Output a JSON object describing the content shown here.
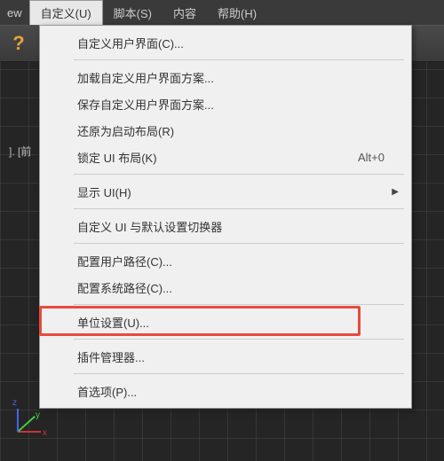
{
  "menubar": {
    "items": [
      {
        "label": "ew"
      },
      {
        "label": "自定义(U)",
        "active": true
      },
      {
        "label": "脚本(S)"
      },
      {
        "label": "内容"
      },
      {
        "label": "帮助(H)"
      }
    ]
  },
  "toolbar": {
    "help_icon": "?"
  },
  "viewport": {
    "label": "]. [前"
  },
  "axis": {
    "x": "x",
    "y": "y",
    "z": "z"
  },
  "dropdown": {
    "items": [
      {
        "type": "item",
        "label": "自定义用户界面(C)..."
      },
      {
        "type": "separator"
      },
      {
        "type": "item",
        "label": "加载自定义用户界面方案..."
      },
      {
        "type": "item",
        "label": "保存自定义用户界面方案..."
      },
      {
        "type": "item",
        "label": "还原为启动布局(R)"
      },
      {
        "type": "item",
        "label": "锁定 UI 布局(K)",
        "shortcut": "Alt+0"
      },
      {
        "type": "separator"
      },
      {
        "type": "item",
        "label": "显示 UI(H)",
        "submenu": true
      },
      {
        "type": "separator"
      },
      {
        "type": "item",
        "label": "自定义 UI 与默认设置切换器"
      },
      {
        "type": "separator"
      },
      {
        "type": "item",
        "label": "配置用户路径(C)..."
      },
      {
        "type": "item",
        "label": "配置系统路径(C)..."
      },
      {
        "type": "separator"
      },
      {
        "type": "item",
        "label": "单位设置(U)...",
        "highlighted": true
      },
      {
        "type": "separator"
      },
      {
        "type": "item",
        "label": "插件管理器..."
      },
      {
        "type": "separator"
      },
      {
        "type": "item",
        "label": "首选项(P)..."
      }
    ]
  }
}
